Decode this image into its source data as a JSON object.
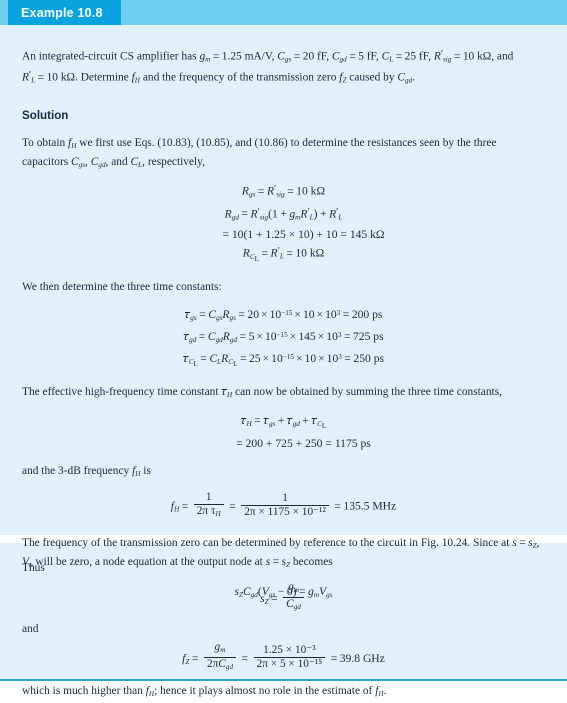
{
  "header": {
    "example_label": "Example 10.8"
  },
  "problem": {
    "line1_pre": "An integrated-circuit CS amplifier has ",
    "gm_symbol": "g",
    "gm_sub": "m",
    "gm_value": "1.25 mA/V",
    "cgs_value": "20 fF",
    "cgd_value": "5 fF",
    "cl_value": "25 fF",
    "rsig_value": "10 kΩ",
    "rl_value": "10 kΩ",
    "line2": "and R'L = 10 kΩ. Determine fH and the frequency of the transmission zero fz caused by Cgd.",
    "text_determine": "Determine ",
    "text_and_freq": " and the frequency of the transmission zero ",
    "text_caused": " caused by "
  },
  "solution": {
    "heading": "Solution",
    "intro_a": "To obtain ",
    "intro_b": " we first use Eqs. (10.83), (10.85), and (10.86) to determine the resistances seen by the three capacitors ",
    "intro_c": ", and ",
    "intro_d": ", respectively,",
    "eq_rgs_value": "10 kΩ",
    "eq_rgd_terms": "(1 + g",
    "eq_rgd_numeric": "= 10(1 + 1.25 × 10) + 10 = 145 kΩ",
    "eq_rcl_value": "10 kΩ",
    "time_constants_intro": "We then determine the three time constants:",
    "tau_gs": "20 × 10⁻¹⁵ × 10 × 10³ = 200 ps",
    "tau_gs_c": "20",
    "tau_gs_r": "10",
    "tau_gs_result": "200 ps",
    "tau_gd_c": "5",
    "tau_gd_r": "145",
    "tau_gd_result": "725 ps",
    "tau_cl_c": "25",
    "tau_cl_r": "10",
    "tau_cl_result": "250 ps",
    "tau_h_intro": "The effective high-frequency time constant τH can now be obtained by summing the three time constants,",
    "tau_h_intro_a": "The effective high-frequency time constant ",
    "tau_h_intro_b": " can now be obtained by summing the three time constants,",
    "tau_h_sum": "= 200 + 725 + 250 = 1175 ps",
    "fh_intro_a": "and the 3-dB frequency ",
    "fh_intro_b": " is",
    "fh_num": "1",
    "fh_den1": "2π τ",
    "fh_den2": "2π × 1175 × 10⁻¹²",
    "fh_result": "135.5 MHz",
    "zero_para_a": "The frequency of the transmission zero can be determined by reference to the circuit in Fig. 10.24. Since at ",
    "zero_para_b": " will be zero, a node equation at the output node at ",
    "zero_para_c": " becomes",
    "node_eq": "szCgd(Vgs − 0) = gmVgs",
    "thus_label": "Thus",
    "and_label": "and",
    "fz_num": "1.25 × 10⁻³",
    "fz_den": "2π × 5 × 10⁻¹⁵",
    "fz_result": "39.8 GHz",
    "closing_a": "which is much higher than ",
    "closing_b": "; hence it plays almost no role in the estimate of ",
    "closing_c": "."
  },
  "colors": {
    "panel_bg": "#e1f1fc",
    "header_band": "#73cef4",
    "tab_bg": "#0aa3e0",
    "rule": "#2ba6dd",
    "text": "#1b2a3a"
  }
}
